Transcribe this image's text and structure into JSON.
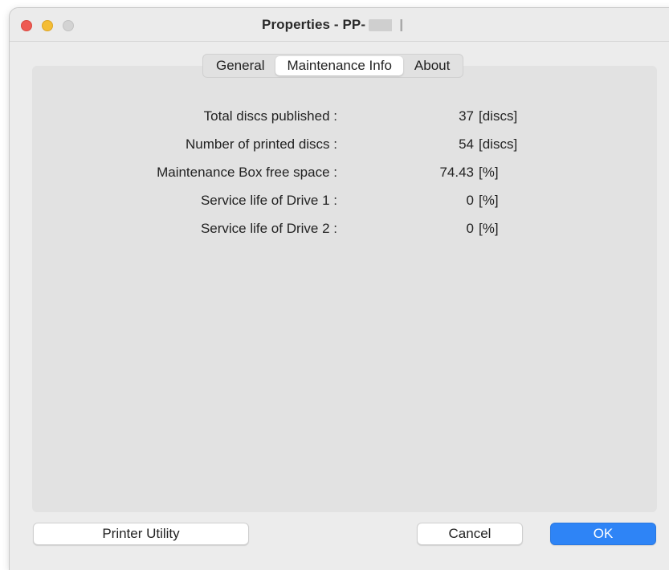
{
  "window": {
    "title": "Properties - PP-",
    "title_redacted": true,
    "traffic_lights": [
      "close",
      "minimize",
      "zoom"
    ]
  },
  "tabs": [
    {
      "label": "General",
      "active": false
    },
    {
      "label": "Maintenance Info",
      "active": true
    },
    {
      "label": "About",
      "active": false
    }
  ],
  "maintenance": {
    "rows": [
      {
        "label": "Total discs published :",
        "value": "37",
        "unit": "[discs]"
      },
      {
        "label": "Number of printed discs :",
        "value": "54",
        "unit": "[discs]"
      },
      {
        "label": "Maintenance Box free space :",
        "value": "74.43",
        "unit": "[%]"
      },
      {
        "label": "Service life of Drive 1 :",
        "value": "0",
        "unit": "[%]"
      },
      {
        "label": "Service life of Drive 2 :",
        "value": "0",
        "unit": "[%]"
      }
    ]
  },
  "buttons": {
    "printer_utility": "Printer Utility",
    "cancel": "Cancel",
    "ok": "OK"
  },
  "colors": {
    "accent": "#2e84f6",
    "window_bg": "#ececec",
    "panel_bg": "#e2e2e2",
    "close": "#ee5a52",
    "minimize": "#f4bd35",
    "zoom_disabled": "#d3d3d3"
  }
}
